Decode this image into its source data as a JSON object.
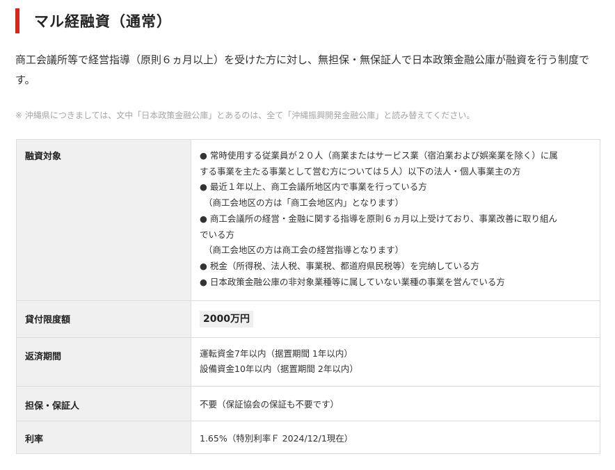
{
  "heading": {
    "title": "マル経融資（通常）"
  },
  "lead": "商工会議所等で経営指導（原則６ヵ月以上）を受けた方に対し、無担保・無保証人で日本政策金融公庫が融資を行う制度です。",
  "note": "※ 沖縄県につきましては、文中「日本政策金融公庫」とあるのは、全て「沖縄振興開発金融公庫」と読み替えてください。",
  "table": {
    "eligibility": {
      "label": "融資対象",
      "lines": [
        "● 常時使用する従業員が２０人（商業またはサービス業（宿泊業および娯楽業を除く）に属",
        "する事業を主たる事業として営む方については５人）以下の法人・個人事業主の方",
        "● 最近１年以上、商工会議所地区内で事業を行っている方",
        "（商工会地区の方は「商工会地区内」となります）",
        "● 商工会議所の経営・金融に関する指導を原則６ヵ月以上受けており、事業改善に取り組ん",
        "でいる方",
        "（商工会地区の方は商工会の経営指導となります）",
        "● 税金（所得税、法人税、事業税、都道府県民税等）を完納している方",
        "● 日本政策金融公庫の非対象業種等に属していない業種の事業を営んでいる方"
      ]
    },
    "limit": {
      "label": "貸付限度額",
      "value": "2000万円"
    },
    "repayment": {
      "label": "返済期間",
      "lines": [
        "運転資金7年以内（据置期間 1年以内）",
        "設備資金10年以内（据置期間 2年以内）"
      ]
    },
    "guarantee": {
      "label": "担保・保証人",
      "value": "不要（保証協会の保証も不要です）"
    },
    "rate": {
      "label": "利率",
      "value": "1.65%（特別利率Ｆ 2024/12/1現在）"
    }
  },
  "colors": {
    "accent": "#d9241b",
    "header_bg": "#f0f0f0",
    "border": "#dcdcdc",
    "note_text": "#a6a6a6"
  }
}
